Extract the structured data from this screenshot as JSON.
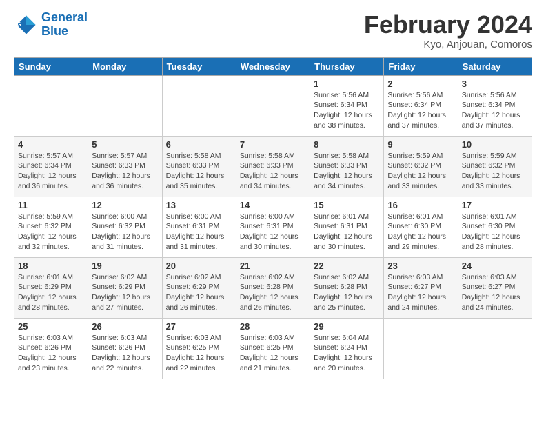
{
  "header": {
    "logo_line1": "General",
    "logo_line2": "Blue",
    "month_title": "February 2024",
    "location": "Kyo, Anjouan, Comoros"
  },
  "days_of_week": [
    "Sunday",
    "Monday",
    "Tuesday",
    "Wednesday",
    "Thursday",
    "Friday",
    "Saturday"
  ],
  "weeks": [
    [
      {
        "day": "",
        "info": ""
      },
      {
        "day": "",
        "info": ""
      },
      {
        "day": "",
        "info": ""
      },
      {
        "day": "",
        "info": ""
      },
      {
        "day": "1",
        "info": "Sunrise: 5:56 AM\nSunset: 6:34 PM\nDaylight: 12 hours\nand 38 minutes."
      },
      {
        "day": "2",
        "info": "Sunrise: 5:56 AM\nSunset: 6:34 PM\nDaylight: 12 hours\nand 37 minutes."
      },
      {
        "day": "3",
        "info": "Sunrise: 5:56 AM\nSunset: 6:34 PM\nDaylight: 12 hours\nand 37 minutes."
      }
    ],
    [
      {
        "day": "4",
        "info": "Sunrise: 5:57 AM\nSunset: 6:34 PM\nDaylight: 12 hours\nand 36 minutes."
      },
      {
        "day": "5",
        "info": "Sunrise: 5:57 AM\nSunset: 6:33 PM\nDaylight: 12 hours\nand 36 minutes."
      },
      {
        "day": "6",
        "info": "Sunrise: 5:58 AM\nSunset: 6:33 PM\nDaylight: 12 hours\nand 35 minutes."
      },
      {
        "day": "7",
        "info": "Sunrise: 5:58 AM\nSunset: 6:33 PM\nDaylight: 12 hours\nand 34 minutes."
      },
      {
        "day": "8",
        "info": "Sunrise: 5:58 AM\nSunset: 6:33 PM\nDaylight: 12 hours\nand 34 minutes."
      },
      {
        "day": "9",
        "info": "Sunrise: 5:59 AM\nSunset: 6:32 PM\nDaylight: 12 hours\nand 33 minutes."
      },
      {
        "day": "10",
        "info": "Sunrise: 5:59 AM\nSunset: 6:32 PM\nDaylight: 12 hours\nand 33 minutes."
      }
    ],
    [
      {
        "day": "11",
        "info": "Sunrise: 5:59 AM\nSunset: 6:32 PM\nDaylight: 12 hours\nand 32 minutes."
      },
      {
        "day": "12",
        "info": "Sunrise: 6:00 AM\nSunset: 6:32 PM\nDaylight: 12 hours\nand 31 minutes."
      },
      {
        "day": "13",
        "info": "Sunrise: 6:00 AM\nSunset: 6:31 PM\nDaylight: 12 hours\nand 31 minutes."
      },
      {
        "day": "14",
        "info": "Sunrise: 6:00 AM\nSunset: 6:31 PM\nDaylight: 12 hours\nand 30 minutes."
      },
      {
        "day": "15",
        "info": "Sunrise: 6:01 AM\nSunset: 6:31 PM\nDaylight: 12 hours\nand 30 minutes."
      },
      {
        "day": "16",
        "info": "Sunrise: 6:01 AM\nSunset: 6:30 PM\nDaylight: 12 hours\nand 29 minutes."
      },
      {
        "day": "17",
        "info": "Sunrise: 6:01 AM\nSunset: 6:30 PM\nDaylight: 12 hours\nand 28 minutes."
      }
    ],
    [
      {
        "day": "18",
        "info": "Sunrise: 6:01 AM\nSunset: 6:29 PM\nDaylight: 12 hours\nand 28 minutes."
      },
      {
        "day": "19",
        "info": "Sunrise: 6:02 AM\nSunset: 6:29 PM\nDaylight: 12 hours\nand 27 minutes."
      },
      {
        "day": "20",
        "info": "Sunrise: 6:02 AM\nSunset: 6:29 PM\nDaylight: 12 hours\nand 26 minutes."
      },
      {
        "day": "21",
        "info": "Sunrise: 6:02 AM\nSunset: 6:28 PM\nDaylight: 12 hours\nand 26 minutes."
      },
      {
        "day": "22",
        "info": "Sunrise: 6:02 AM\nSunset: 6:28 PM\nDaylight: 12 hours\nand 25 minutes."
      },
      {
        "day": "23",
        "info": "Sunrise: 6:03 AM\nSunset: 6:27 PM\nDaylight: 12 hours\nand 24 minutes."
      },
      {
        "day": "24",
        "info": "Sunrise: 6:03 AM\nSunset: 6:27 PM\nDaylight: 12 hours\nand 24 minutes."
      }
    ],
    [
      {
        "day": "25",
        "info": "Sunrise: 6:03 AM\nSunset: 6:26 PM\nDaylight: 12 hours\nand 23 minutes."
      },
      {
        "day": "26",
        "info": "Sunrise: 6:03 AM\nSunset: 6:26 PM\nDaylight: 12 hours\nand 22 minutes."
      },
      {
        "day": "27",
        "info": "Sunrise: 6:03 AM\nSunset: 6:25 PM\nDaylight: 12 hours\nand 22 minutes."
      },
      {
        "day": "28",
        "info": "Sunrise: 6:03 AM\nSunset: 6:25 PM\nDaylight: 12 hours\nand 21 minutes."
      },
      {
        "day": "29",
        "info": "Sunrise: 6:04 AM\nSunset: 6:24 PM\nDaylight: 12 hours\nand 20 minutes."
      },
      {
        "day": "",
        "info": ""
      },
      {
        "day": "",
        "info": ""
      }
    ]
  ]
}
